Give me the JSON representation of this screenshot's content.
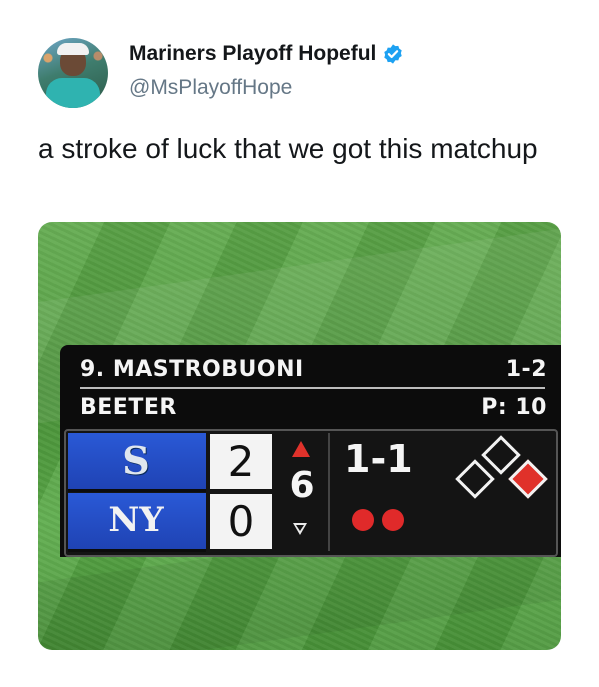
{
  "tweet": {
    "display_name": "Mariners Playoff Hopeful",
    "handle": "@MsPlayoffHope",
    "verified_icon": "verified-badge-icon",
    "text": "a stroke of luck that we got this matchup"
  },
  "scoreboard": {
    "batter": "9. MASTROBUONI",
    "count_label": "1-2",
    "pitcher": "BEETER",
    "pitch_count": "P: 10",
    "teams": [
      {
        "logo": "S",
        "logo_icon": "mariners-logo-icon",
        "score": "2"
      },
      {
        "logo": "NY",
        "logo_icon": "yankees-logo-icon",
        "score": "0"
      }
    ],
    "inning": "6",
    "inning_half": "top",
    "count": "1-1",
    "outs": 2,
    "bases": {
      "first": true,
      "second": false,
      "third": false
    },
    "colors": {
      "accent_red": "#e0312a",
      "team_blue": "#2a59d6"
    }
  }
}
